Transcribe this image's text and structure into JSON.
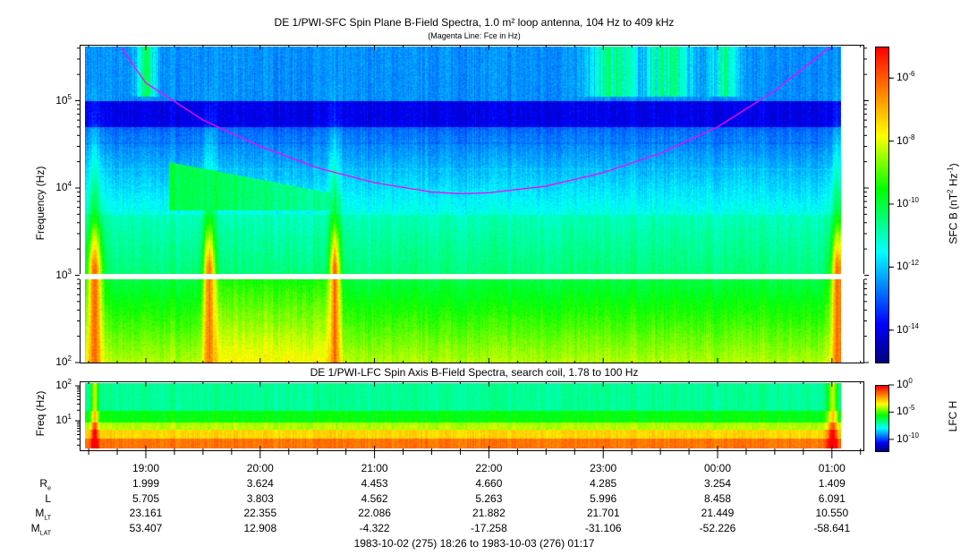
{
  "chart_data": [
    {
      "type": "heatmap",
      "title": "DE 1/PWI-SFC  Spin Plane B-Field Spectra, 1.0 m² loop antenna, 104 Hz to 409 kHz",
      "subtitle": "(Magenta Line: Fce in Hz)",
      "ylabel": "Frequency (Hz)",
      "yscale": "log",
      "ylim": [
        100,
        409000
      ],
      "yticks": [
        {
          "label": "10",
          "exp": "2",
          "value": 100
        },
        {
          "label": "10",
          "exp": "3",
          "value": 1000
        },
        {
          "label": "10",
          "exp": "4",
          "value": 10000
        },
        {
          "label": "10",
          "exp": "5",
          "value": 100000
        }
      ],
      "colorbar": {
        "label": "SFC B (nT",
        "label_sup1": "2",
        "label_mid": " Hz",
        "label_sup2": "-1",
        "label_end": ")",
        "range_log10": [
          -15,
          -5
        ],
        "ticks": [
          {
            "label": "10",
            "exp": "-6",
            "value": -6
          },
          {
            "label": "10",
            "exp": "-8",
            "value": -8
          },
          {
            "label": "10",
            "exp": "-10",
            "value": -10
          },
          {
            "label": "10",
            "exp": "-12",
            "value": -12
          },
          {
            "label": "10",
            "exp": "-14",
            "value": -14
          }
        ]
      },
      "fce_line": {
        "color": "#ff00ff",
        "time_hours": [
          18.78,
          19.0,
          19.5,
          20.0,
          20.5,
          21.0,
          21.5,
          21.75,
          22.0,
          22.5,
          23.0,
          23.5,
          24.0,
          24.5,
          24.98
        ],
        "freq_hz": [
          409000,
          160000,
          60000,
          30000,
          17000,
          11500,
          9000,
          8600,
          8800,
          10500,
          15000,
          25000,
          50000,
          130000,
          409000
        ]
      }
    },
    {
      "type": "heatmap",
      "title": "DE 1/PWI-LFC  Spin Axis B-Field Spectra, search coil, 1.78 to 100 Hz",
      "ylabel": "Freq (Hz)",
      "yscale": "log",
      "ylim": [
        1.78,
        100
      ],
      "yticks": [
        {
          "label": "10",
          "exp": "2",
          "value": 100
        },
        {
          "label": "10",
          "exp": "1",
          "value": 10
        }
      ],
      "colorbar": {
        "label": "LFC H",
        "range_log10": [
          -12,
          0
        ],
        "ticks": [
          {
            "label": "10",
            "exp": "0",
            "value": 0
          },
          {
            "label": "10",
            "exp": "-5",
            "value": -5
          },
          {
            "label": "10",
            "exp": "-10",
            "value": -10
          }
        ]
      }
    }
  ],
  "time_axis": {
    "start_hours": 18.433,
    "end_hours": 25.283,
    "ticks": [
      {
        "label": "19:00",
        "hours": 19
      },
      {
        "label": "20:00",
        "hours": 20
      },
      {
        "label": "21:00",
        "hours": 21
      },
      {
        "label": "22:00",
        "hours": 22
      },
      {
        "label": "23:00",
        "hours": 23
      },
      {
        "label": "00:00",
        "hours": 24
      },
      {
        "label": "01:00",
        "hours": 25
      }
    ],
    "range_label": "1983-10-02 (275) 18:26 to 1983-10-03 (276) 01:17"
  },
  "ephemeris": [
    {
      "label": "R",
      "sub": "e",
      "values": [
        "1.999",
        "3.624",
        "4.453",
        "4.660",
        "4.285",
        "3.254",
        "1.409"
      ]
    },
    {
      "label": "L",
      "sub": "",
      "values": [
        "5.705",
        "3.803",
        "4.562",
        "5.263",
        "5.996",
        "8.458",
        "6.091"
      ]
    },
    {
      "label": "M",
      "sub": "LT",
      "values": [
        "23.161",
        "22.355",
        "22.086",
        "21.882",
        "21.701",
        "21.449",
        "10.550"
      ]
    },
    {
      "label": "M",
      "sub": "LAT",
      "values": [
        "53.407",
        "12.908",
        "-4.322",
        "-17.258",
        "-31.106",
        "-52.226",
        "-58.641"
      ]
    }
  ]
}
